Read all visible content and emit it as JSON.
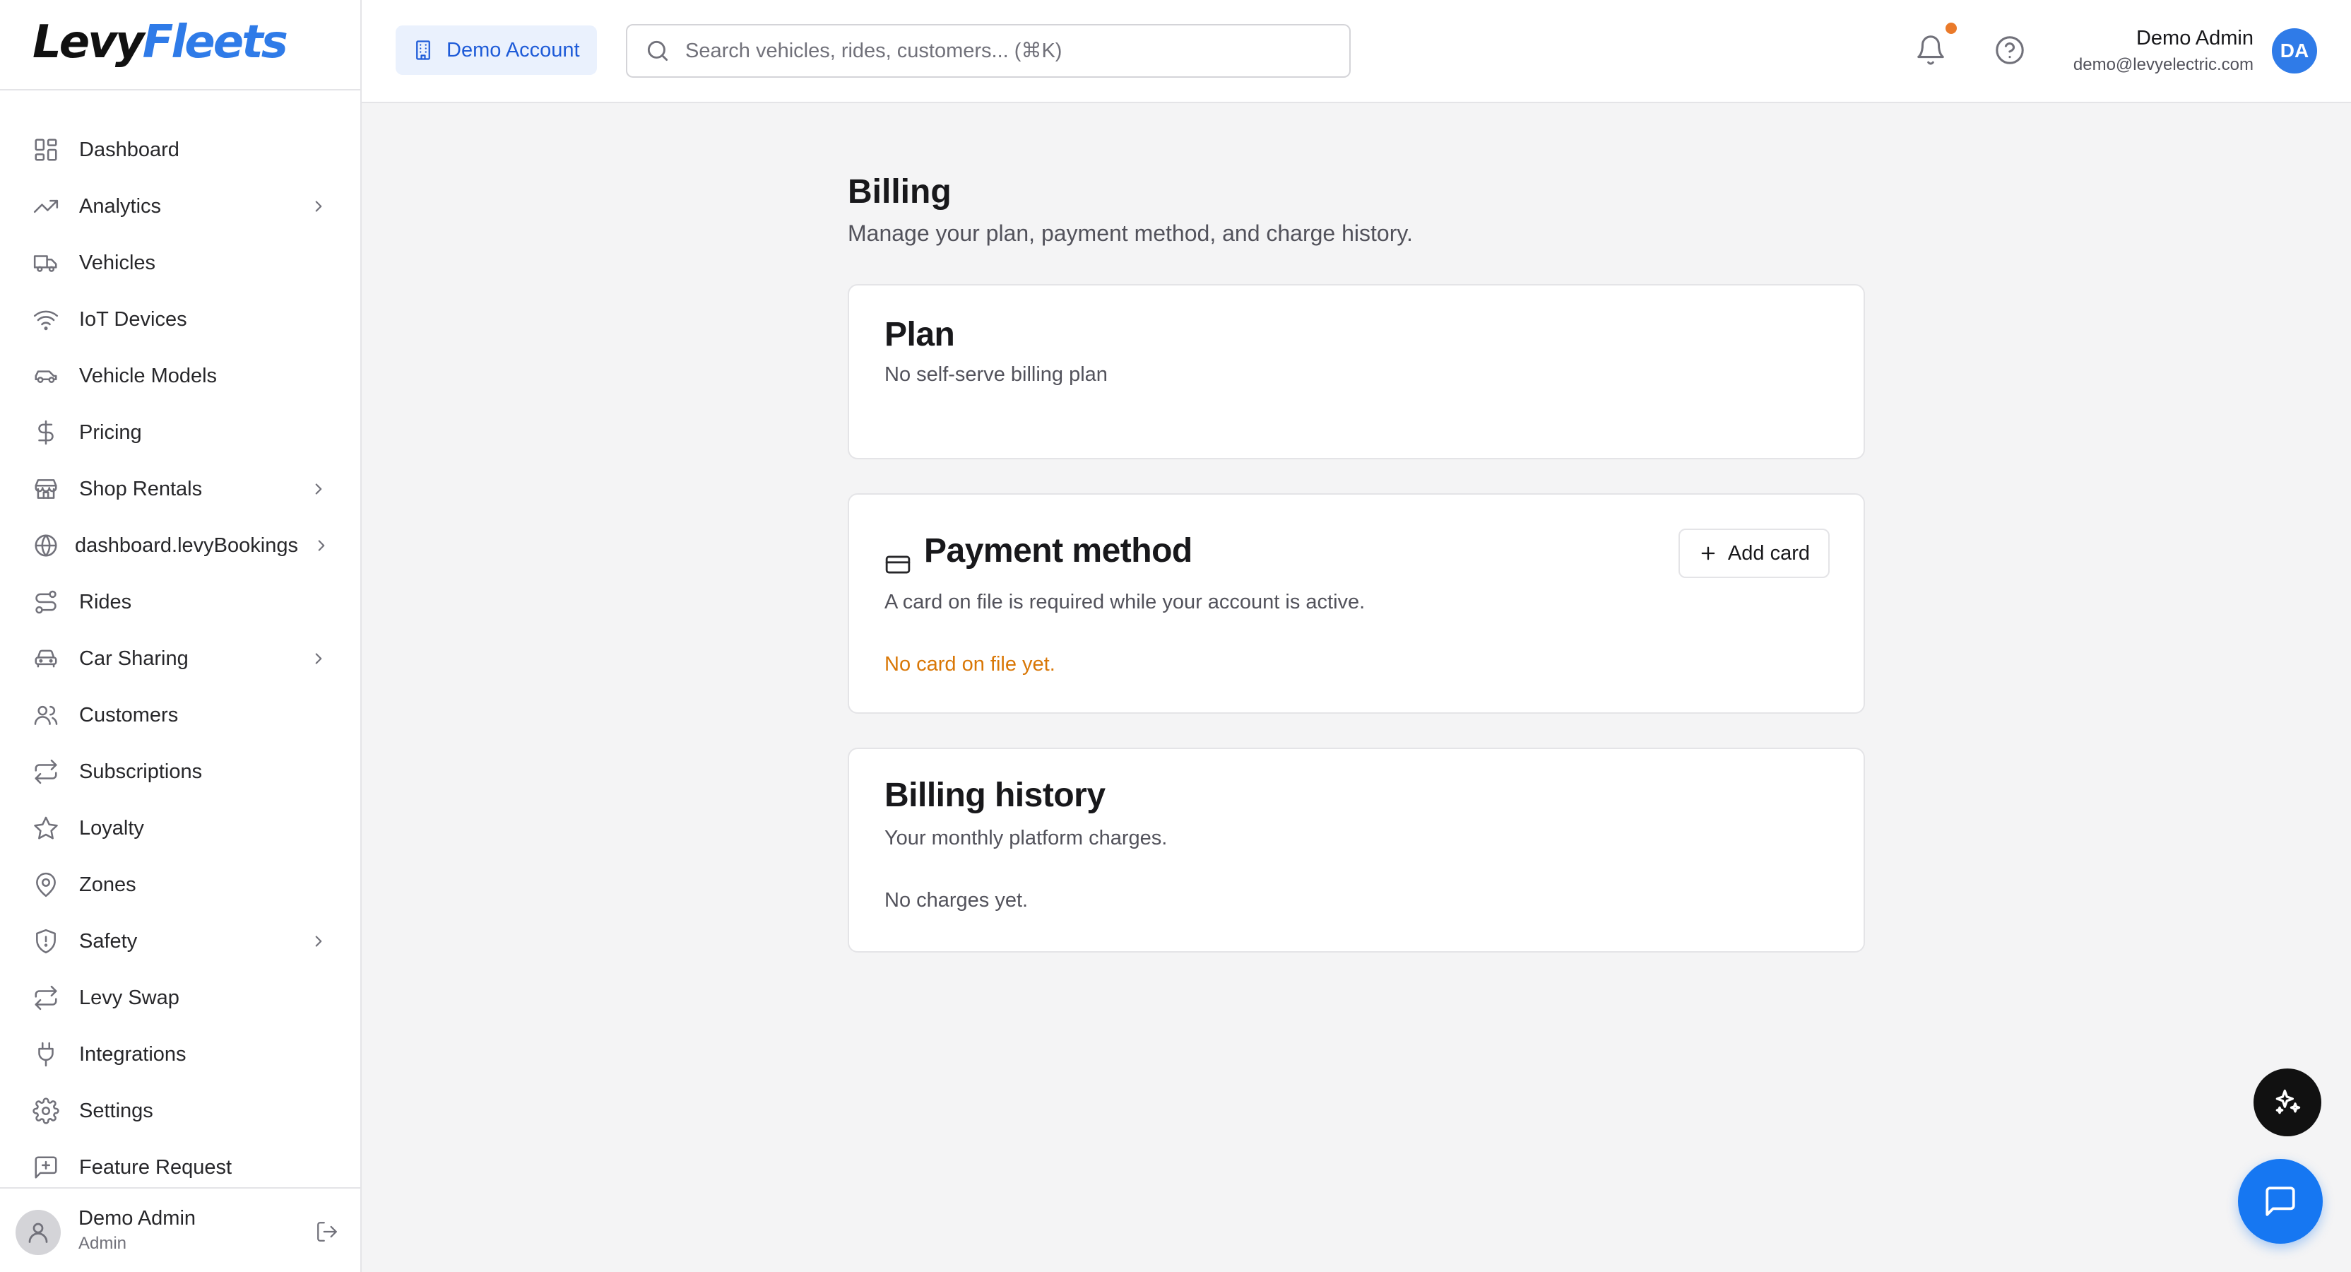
{
  "brand": {
    "name_part1": "Levy",
    "name_part2": "Fleets"
  },
  "sidebar": {
    "items": [
      {
        "label": "Dashboard",
        "icon": "dashboard-icon",
        "has_children": false
      },
      {
        "label": "Analytics",
        "icon": "analytics-icon",
        "has_children": true
      },
      {
        "label": "Vehicles",
        "icon": "truck-icon",
        "has_children": false
      },
      {
        "label": "IoT Devices",
        "icon": "wifi-icon",
        "has_children": false
      },
      {
        "label": "Vehicle Models",
        "icon": "car-icon",
        "has_children": false
      },
      {
        "label": "Pricing",
        "icon": "dollar-icon",
        "has_children": false
      },
      {
        "label": "Shop Rentals",
        "icon": "store-icon",
        "has_children": true
      },
      {
        "label": "dashboard.levyBookings",
        "icon": "globe-icon",
        "has_children": true
      },
      {
        "label": "Rides",
        "icon": "route-icon",
        "has_children": false
      },
      {
        "label": "Car Sharing",
        "icon": "car-front-icon",
        "has_children": true
      },
      {
        "label": "Customers",
        "icon": "users-icon",
        "has_children": false
      },
      {
        "label": "Subscriptions",
        "icon": "repeat-icon",
        "has_children": false
      },
      {
        "label": "Loyalty",
        "icon": "star-icon",
        "has_children": false
      },
      {
        "label": "Zones",
        "icon": "map-pin-icon",
        "has_children": false
      },
      {
        "label": "Safety",
        "icon": "shield-icon",
        "has_children": true
      },
      {
        "label": "Levy Swap",
        "icon": "swap-icon",
        "has_children": false
      },
      {
        "label": "Integrations",
        "icon": "plug-icon",
        "has_children": false
      },
      {
        "label": "Settings",
        "icon": "gear-icon",
        "has_children": false
      },
      {
        "label": "Feature Request",
        "icon": "message-plus-icon",
        "has_children": false
      }
    ],
    "user": {
      "name": "Demo Admin",
      "role": "Admin"
    }
  },
  "header": {
    "account_label": "Demo Account",
    "search_placeholder": "Search vehicles, rides, customers... (⌘K)",
    "user": {
      "name": "Demo Admin",
      "email": "demo@levyelectric.com",
      "initials": "DA"
    },
    "notification_dot_color": "#ea7a2a"
  },
  "main": {
    "title": "Billing",
    "subtitle": "Manage your plan, payment method, and charge history.",
    "plan": {
      "title": "Plan",
      "description": "No self-serve billing plan"
    },
    "payment": {
      "title": "Payment method",
      "description": "A card on file is required while your account is active.",
      "status": "No card on file yet.",
      "status_color": "#d97706",
      "add_button": "Add card"
    },
    "history": {
      "title": "Billing history",
      "description": "Your monthly platform charges.",
      "empty": "No charges yet."
    }
  },
  "colors": {
    "accent": "#2f7be8",
    "chat_button": "#1677f2"
  }
}
